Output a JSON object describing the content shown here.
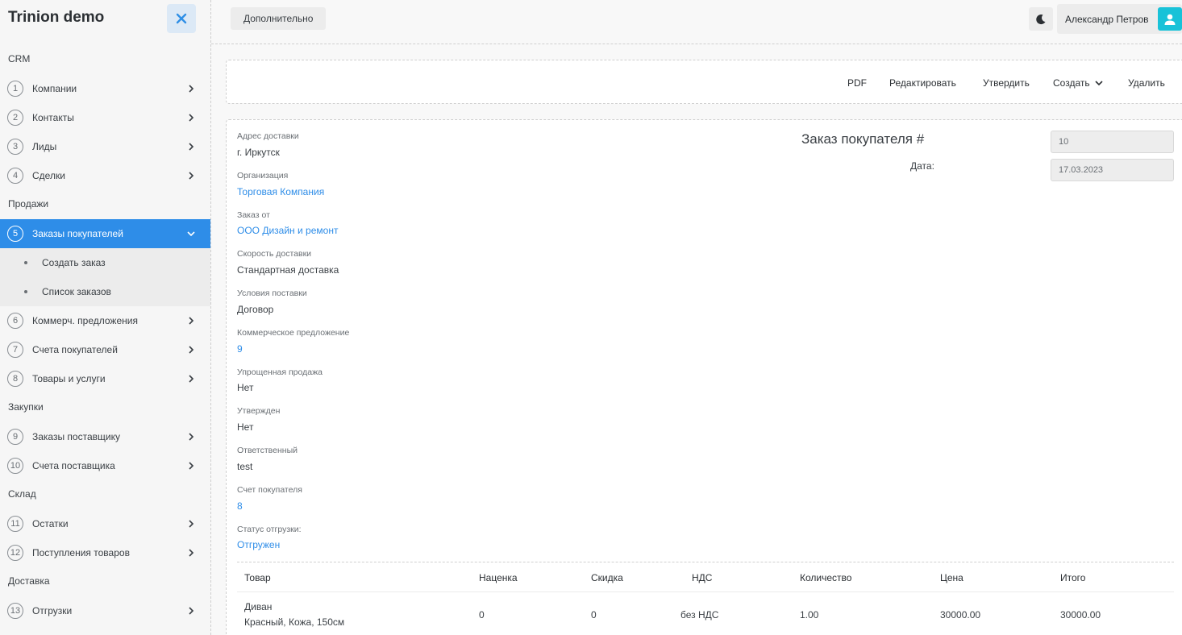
{
  "brand": "Trinion demo",
  "sidebar": {
    "sections": {
      "crm": "CRM",
      "sales": "Продажи",
      "purchases": "Закупки",
      "warehouse": "Склад",
      "delivery": "Доставка"
    },
    "items": [
      {
        "num": "1",
        "label": "Компании"
      },
      {
        "num": "2",
        "label": "Контакты"
      },
      {
        "num": "3",
        "label": "Лиды"
      },
      {
        "num": "4",
        "label": "Сделки"
      },
      {
        "num": "5",
        "label": "Заказы покупателей"
      },
      {
        "num": "6",
        "label": "Коммерч. предложения"
      },
      {
        "num": "7",
        "label": "Счета покупателей"
      },
      {
        "num": "8",
        "label": "Товары и услуги"
      },
      {
        "num": "9",
        "label": "Заказы поставщику"
      },
      {
        "num": "10",
        "label": "Счета поставщика"
      },
      {
        "num": "11",
        "label": "Остатки"
      },
      {
        "num": "12",
        "label": "Поступления товаров"
      },
      {
        "num": "13",
        "label": "Отгрузки"
      }
    ],
    "subitems": [
      "Создать заказ",
      "Список заказов"
    ]
  },
  "topbar": {
    "extra_button": "Дополнительно",
    "user_name": "Александр Петров"
  },
  "actions": {
    "pdf": "PDF",
    "edit": "Редактировать",
    "approve": "Утвердить",
    "create": "Создать",
    "delete": "Удалить"
  },
  "order": {
    "title": "Заказ покупателя #",
    "number": "10",
    "date_label": "Дата:",
    "date": "17.03.2023"
  },
  "fields": [
    {
      "label": "Адрес доставки",
      "value": "г. Иркутск"
    },
    {
      "label": "Организация",
      "value": "Торговая Компания"
    },
    {
      "label": "Заказ от",
      "value": "ООО Дизайн и ремонт"
    },
    {
      "label": "Скорость доставки",
      "value": "Стандартная доставка"
    },
    {
      "label": "Условия поставки",
      "value": "Договор"
    },
    {
      "label": "Коммерческое предложение",
      "value": "9"
    },
    {
      "label": "Упрощенная продажа",
      "value": "Нет"
    },
    {
      "label": "Утвержден",
      "value": "Нет"
    },
    {
      "label": "Ответственный",
      "value": "test"
    },
    {
      "label": "Счет покупателя",
      "value": "8"
    },
    {
      "label": "Статус отгрузки:",
      "value": "Отгружен"
    }
  ],
  "table": {
    "headers": [
      "Товар",
      "Наценка",
      "Скидка",
      "НДС",
      "Количество",
      "Цена",
      "Итого"
    ],
    "rows": [
      {
        "product": "Диван",
        "product_desc": "Красный, Кожа, 150см",
        "markup": "0",
        "discount": "0",
        "vat": "без НДС",
        "qty": "1.00",
        "price": "30000.00",
        "total": "30000.00"
      }
    ]
  },
  "colors": {
    "accent": "#2e8de8",
    "avatar": "#18c2d8",
    "close_bg": "#dce9f6"
  }
}
